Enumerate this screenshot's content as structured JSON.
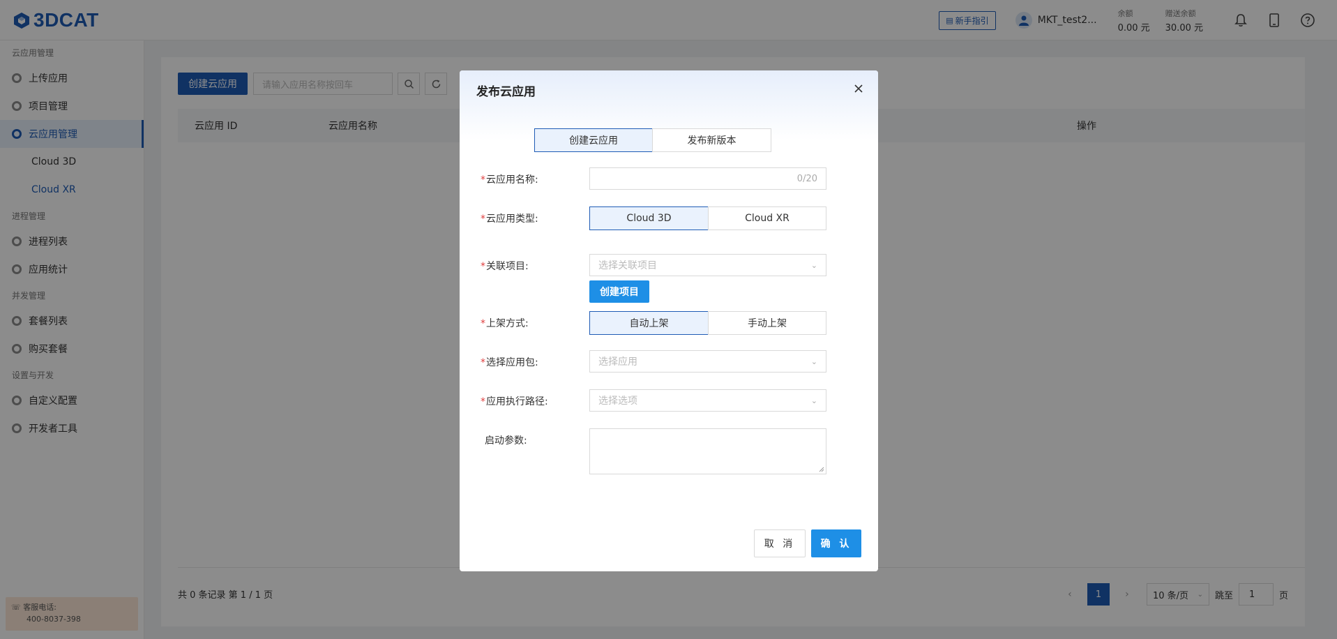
{
  "header": {
    "brand": "3DCAT",
    "guide_label": "新手指引",
    "user_name": "MKT_test2...",
    "balance_label": "余额",
    "balance_value": "0.00 元",
    "gift_label": "赠送余额",
    "gift_value": "30.00 元",
    "icons": [
      "bell-icon",
      "tablet-icon",
      "help-icon"
    ]
  },
  "sidebar": {
    "groups": [
      {
        "label": "云应用管理"
      },
      {
        "label": "进程管理"
      },
      {
        "label": "并发管理"
      },
      {
        "label": "设置与开发"
      }
    ],
    "items": {
      "upload": "上传应用",
      "project": "项目管理",
      "cloud_app": "云应用管理",
      "cloud3d": "Cloud 3D",
      "cloudxr": "Cloud XR",
      "process_list": "进程列表",
      "app_stats": "应用统计",
      "package_list": "套餐列表",
      "buy_package": "购买套餐",
      "custom_config": "自定义配置",
      "dev_tools": "开发者工具"
    },
    "support_label": "客服电话:",
    "support_phone": "400-8037-398"
  },
  "main": {
    "create_button": "创建云应用",
    "search_placeholder": "请输入应用名称按回车",
    "columns": [
      "云应用 ID",
      "云应用名称",
      "操作"
    ],
    "pager_info": "共 0 条记录 第 1 / 1 页",
    "current_page": "1",
    "page_size": "10 条/页",
    "jump_label": "跳至",
    "jump_value": "1",
    "page_unit": "页"
  },
  "modal": {
    "title": "发布云应用",
    "mode_tabs": [
      "创建云应用",
      "发布新版本"
    ],
    "fields": {
      "name_label": "云应用名称:",
      "name_counter": "0/20",
      "type_label": "云应用类型:",
      "type_options": [
        "Cloud 3D",
        "Cloud XR"
      ],
      "project_label": "关联项目:",
      "project_placeholder": "选择关联项目",
      "create_project": "创建项目",
      "listing_label": "上架方式:",
      "listing_options": [
        "自动上架",
        "手动上架"
      ],
      "package_label": "选择应用包:",
      "package_placeholder": "选择应用",
      "path_label": "应用执行路径:",
      "path_placeholder": "选择选项",
      "params_label": "启动参数:"
    },
    "required_mark": "*",
    "cancel": "取 消",
    "confirm": "确 认"
  },
  "colors": {
    "brand": "#1e5bb5",
    "accent": "#1e8fe6",
    "required": "#e04040"
  }
}
